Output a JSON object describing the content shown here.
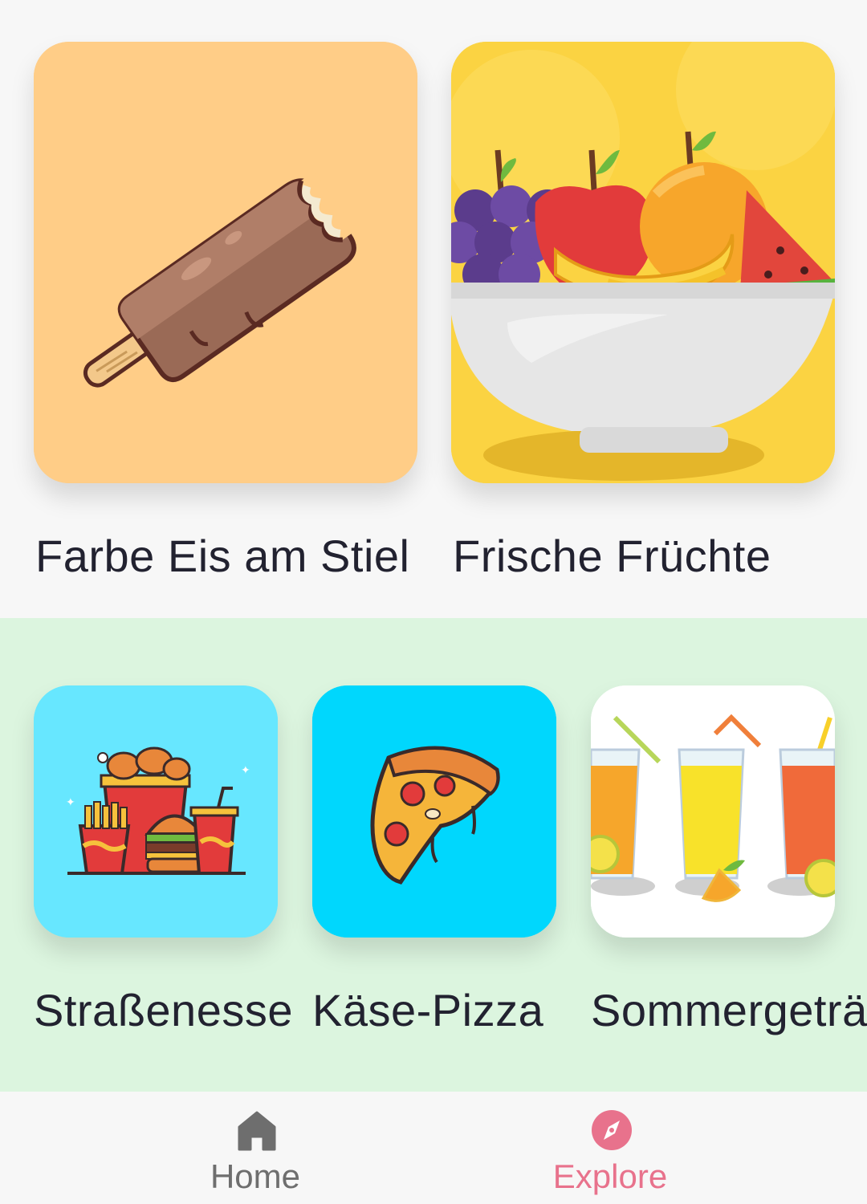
{
  "featured": [
    {
      "label": "Farbe Eis am Stiel",
      "image": "popsicle-illustration"
    },
    {
      "label": "Frische Früchte",
      "image": "fruit-bowl-illustration"
    }
  ],
  "categories": [
    {
      "label": "Straßenesse",
      "image": "street-food-illustration"
    },
    {
      "label": "Käse-Pizza",
      "image": "pizza-illustration"
    },
    {
      "label": "Sommergeträ",
      "image": "summer-drinks-illustration"
    }
  ],
  "bottom_nav": {
    "items": [
      {
        "label": "Home",
        "icon": "home-icon",
        "active": false
      },
      {
        "label": "Explore",
        "icon": "compass-icon",
        "active": true
      }
    ]
  },
  "colors": {
    "active": "#e8728c",
    "inactive": "#6e6e6e",
    "popsicle_bg": "#ffcd87",
    "fruit_bg": "#fbd342",
    "street_food_bg": "#67e7ff",
    "pizza_bg": "#00d7fd",
    "drinks_bg": "#ffffff",
    "category_section_bg": "#dcf5df"
  }
}
